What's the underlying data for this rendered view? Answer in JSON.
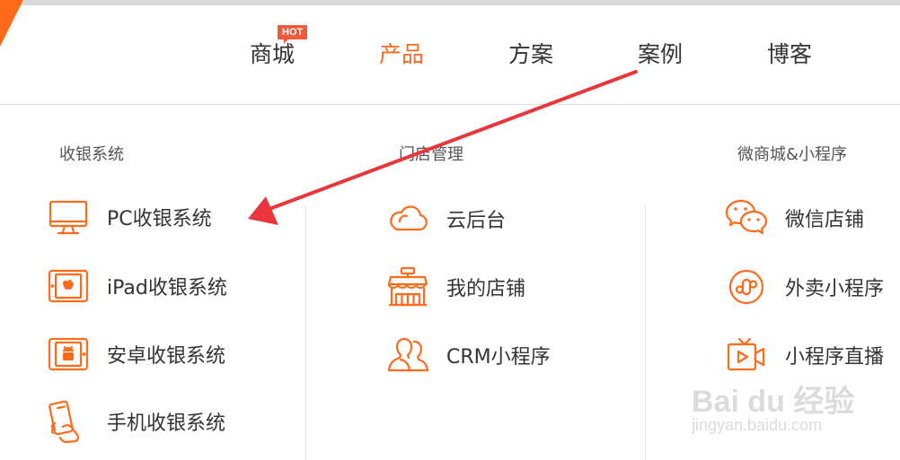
{
  "nav": {
    "items": [
      {
        "label": "商城",
        "active": false
      },
      {
        "label": "产品",
        "active": true
      },
      {
        "label": "方案",
        "active": false
      },
      {
        "label": "案例",
        "active": false
      },
      {
        "label": "博客",
        "active": false
      }
    ],
    "hot_badge": "HOT"
  },
  "columns": [
    {
      "title": "收银系统",
      "items": [
        {
          "label": "PC收银系统",
          "icon": "monitor-icon"
        },
        {
          "label": "iPad收银系统",
          "icon": "ipad-icon"
        },
        {
          "label": "安卓收银系统",
          "icon": "android-tablet-icon"
        },
        {
          "label": "手机收银系统",
          "icon": "phone-hand-icon"
        }
      ]
    },
    {
      "title": "门店管理",
      "items": [
        {
          "label": "云后台",
          "icon": "cloud-icon"
        },
        {
          "label": "我的店铺",
          "icon": "storefront-icon"
        },
        {
          "label": "CRM小程序",
          "icon": "users-icon"
        }
      ]
    },
    {
      "title": "微商城&小程序",
      "items": [
        {
          "label": "微信店铺",
          "icon": "wechat-icon"
        },
        {
          "label": "外卖小程序",
          "icon": "mini-program-icon"
        },
        {
          "label": "小程序直播",
          "icon": "live-camera-icon"
        }
      ]
    }
  ],
  "watermark": {
    "main": "Bai du 经验",
    "sub": "jingyan.baidu.com"
  },
  "colors": {
    "accent": "#ff6a1a",
    "annotation_arrow": "#e8363a",
    "hot_badge": "#ef5a3c"
  }
}
